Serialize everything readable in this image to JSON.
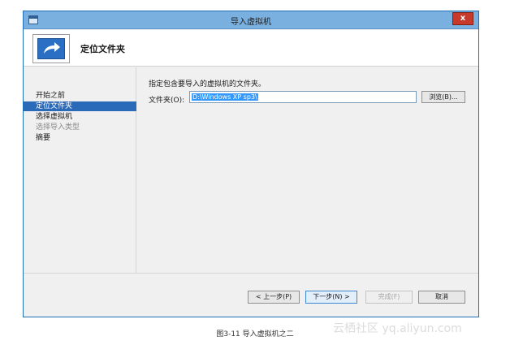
{
  "window": {
    "title": "导入虚拟机",
    "close_label": "x"
  },
  "header": {
    "title": "定位文件夹",
    "icon": "arrow-forward-icon"
  },
  "sidebar": {
    "items": [
      {
        "label": "开始之前",
        "state": "normal"
      },
      {
        "label": "定位文件夹",
        "state": "selected"
      },
      {
        "label": "选择虚拟机",
        "state": "normal"
      },
      {
        "label": "选择导入类型",
        "state": "disabled"
      },
      {
        "label": "摘要",
        "state": "normal"
      }
    ]
  },
  "main": {
    "instruction": "指定包含要导入的虚拟机的文件夹。",
    "folder_label": "文件夹(O):",
    "folder_value": "D:\\Windows XP sp3\\",
    "browse_label": "浏览(B)..."
  },
  "buttons": {
    "prev": "< 上一步(P)",
    "next": "下一步(N) >",
    "finish": "完成(F)",
    "cancel": "取消"
  },
  "caption": "图3-11 导入虚拟机之二",
  "watermark": "云栖社区 yq.aliyun.com",
  "colors": {
    "titlebar": "#7ab0e0",
    "close": "#c7392a",
    "selected": "#2b69b9",
    "icon": "#2a6fc4"
  }
}
